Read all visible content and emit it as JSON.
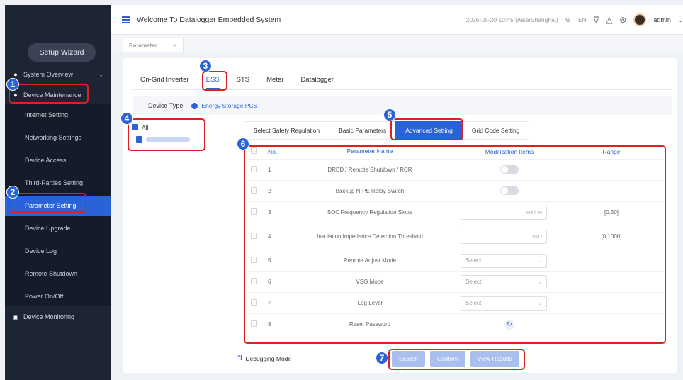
{
  "sidebar": {
    "wizard_label": "Setup Wizard",
    "groups": {
      "overview": "System Overview",
      "maintenance": "Device Maintenance",
      "monitoring": "Device Monitoring"
    },
    "items": [
      {
        "label": "Internet Setting"
      },
      {
        "label": "Networking Settings"
      },
      {
        "label": "Device Access"
      },
      {
        "label": "Third-Parties Setting"
      },
      {
        "label": "Parameter Setting"
      },
      {
        "label": "Device Upgrade"
      },
      {
        "label": "Device Log"
      },
      {
        "label": "Remote Shutdown"
      },
      {
        "label": "Power On/Off"
      }
    ]
  },
  "header": {
    "title": "Welcome To Datalogger Embedded System",
    "datetime": "2026-05-20 10:45 (Asia/Shanghai)",
    "language": "EN",
    "user": "admin"
  },
  "page_tab": "Parameter ...",
  "device_tabs": [
    "On-Grid Inverter",
    "ESS",
    "STS",
    "Meter",
    "Datalogger"
  ],
  "device_type": {
    "label": "Device Type",
    "value": "Energy Storage PCS"
  },
  "tree": {
    "all_label": "All"
  },
  "sub_tabs": [
    "Select Safety Regulation",
    "Basic Parameters",
    "Advanced Setting",
    "Grid Code Setting"
  ],
  "table": {
    "headers": {
      "no": "No.",
      "name": "Parameter Name",
      "mod": "Modification Items",
      "range": "Range"
    },
    "rows": [
      {
        "no": "1",
        "name": "DRED / Remote Shutdown / RCR",
        "type": "toggle",
        "unit": "",
        "range": ""
      },
      {
        "no": "2",
        "name": "Backup N-PE Relay Switch",
        "type": "toggle",
        "unit": "",
        "range": ""
      },
      {
        "no": "3",
        "name": "SOC Frequency Regulation Slope",
        "type": "input",
        "unit": "Hz / %",
        "range": "[0.50]"
      },
      {
        "no": "4",
        "name": "Insulation Impedance Detection Threshold",
        "type": "input",
        "unit": "10kΩ",
        "range": "[0,1000]"
      },
      {
        "no": "5",
        "name": "Remote Adjust Mode",
        "type": "select",
        "unit": "Select",
        "range": ""
      },
      {
        "no": "6",
        "name": "VSG Mode",
        "type": "select",
        "unit": "Select",
        "range": ""
      },
      {
        "no": "7",
        "name": "Log Level",
        "type": "select",
        "unit": "Select",
        "range": ""
      },
      {
        "no": "8",
        "name": "Reset Password",
        "type": "reset",
        "unit": "",
        "range": ""
      }
    ]
  },
  "debug_label": "Debugging Mode",
  "actions": {
    "search": "Search",
    "confirm": "Confirm",
    "results": "View Results"
  },
  "markers": [
    "1",
    "2",
    "3",
    "4",
    "5",
    "6",
    "7"
  ],
  "colors": {
    "accent": "#2a63d8",
    "annotation": "#e02020"
  }
}
